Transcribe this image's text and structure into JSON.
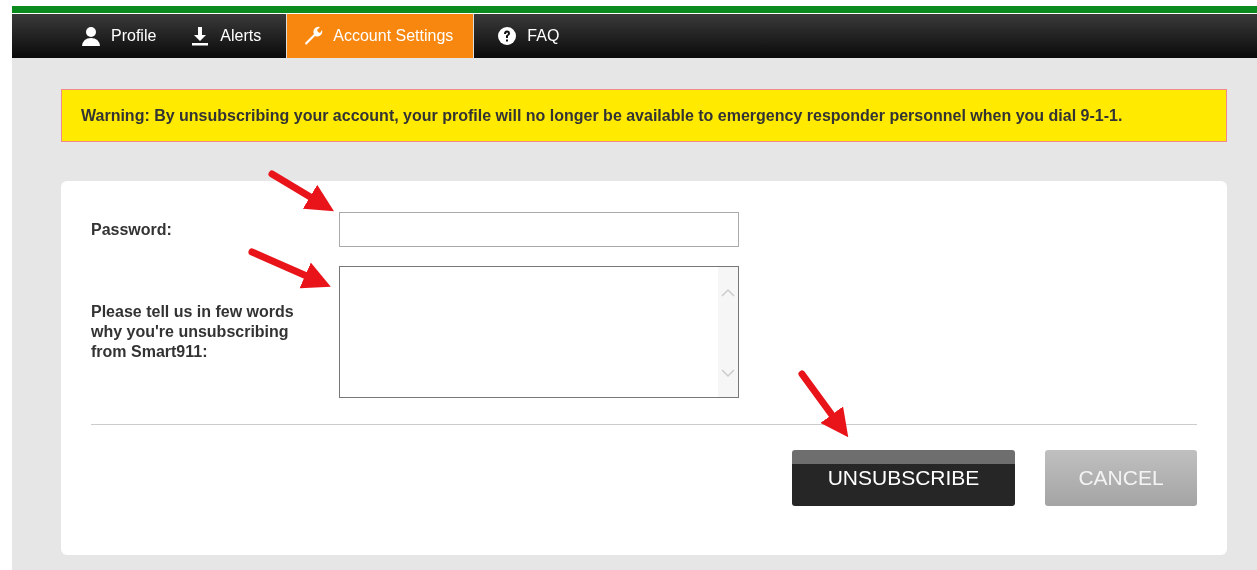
{
  "nav": {
    "tabs": [
      {
        "label": "Profile",
        "kind": "user",
        "selected": false
      },
      {
        "label": "Alerts",
        "kind": "download",
        "selected": false
      },
      {
        "label": "Account Settings",
        "kind": "wrench",
        "selected": true
      },
      {
        "label": "FAQ",
        "kind": "question",
        "selected": false
      }
    ]
  },
  "warning": "Warning: By unsubscribing your account, your profile will no longer be available to emergency responder personnel when you dial 9-1-1.",
  "form": {
    "password_label": "Password:",
    "reason_label": "Please tell us in few words why you're unsubscribing from Smart911:"
  },
  "buttons": [
    {
      "label": "UNSUBSCRIBE",
      "kind": "primary"
    },
    {
      "label": "CANCEL",
      "kind": "secondary"
    }
  ]
}
